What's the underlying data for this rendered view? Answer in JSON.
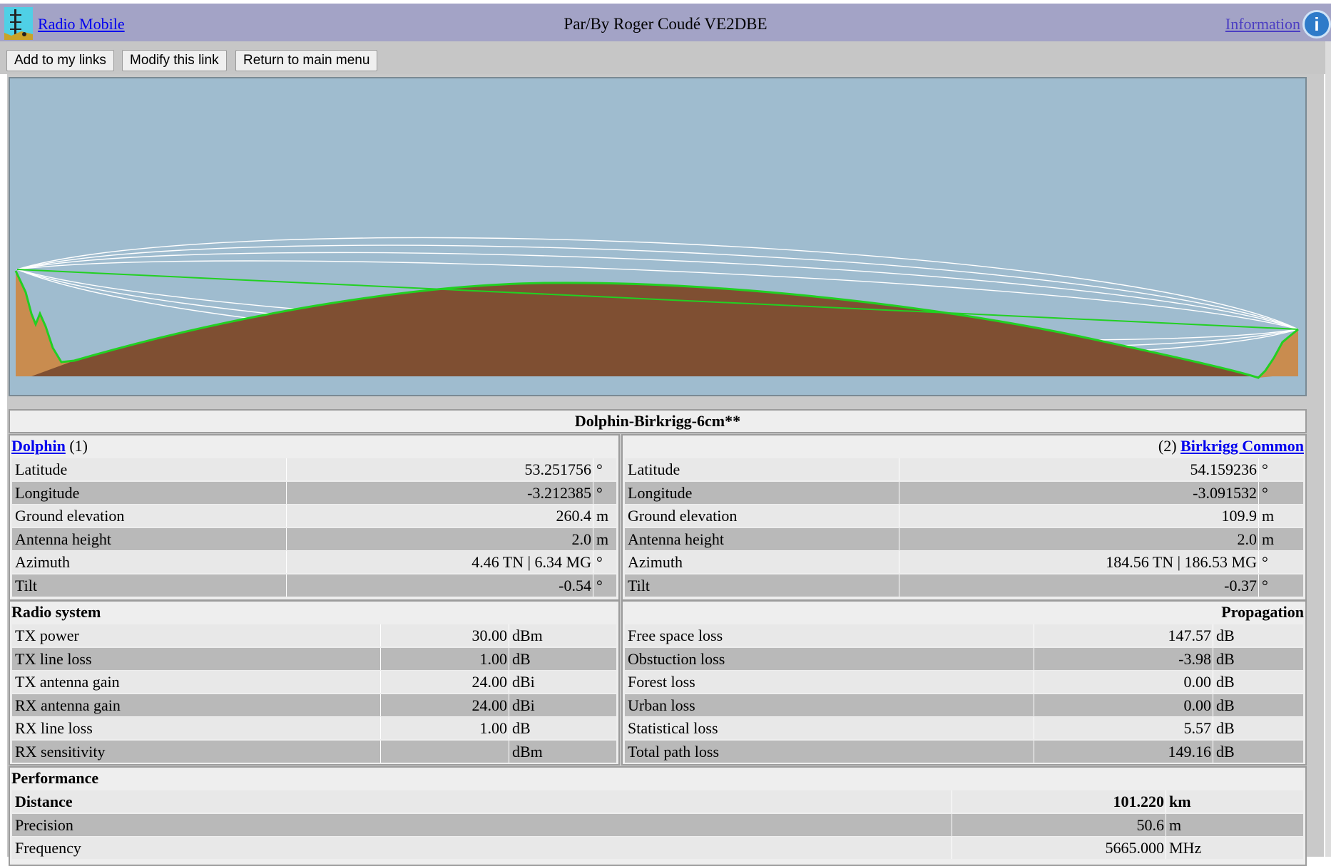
{
  "header": {
    "app_link": "Radio Mobile",
    "credit": "Par/By Roger Coudé VE2DBE",
    "info_link": "Information",
    "info_icon": "i"
  },
  "toolbar": {
    "add_label": "Add to my links",
    "modify_label": "Modify this link",
    "return_label": "Return to main menu"
  },
  "profile": {
    "sky_color": "#9fbccf",
    "terrain_color": "#7f4f32",
    "terrain_edge_color": "#c98c4f",
    "los_color": "#22d022",
    "fresnel_color": "#ffffff"
  },
  "link_title": "Dolphin-Birkrigg-6cm**",
  "site1": {
    "name": "Dolphin",
    "index": "(1)",
    "rows": [
      {
        "label": "Latitude",
        "value": "53.251756",
        "unit": "°"
      },
      {
        "label": "Longitude",
        "value": "-3.212385",
        "unit": "°"
      },
      {
        "label": "Ground elevation",
        "value": "260.4",
        "unit": "m"
      },
      {
        "label": "Antenna height",
        "value": "2.0",
        "unit": "m"
      },
      {
        "label": "Azimuth",
        "value": "4.46 TN | 6.34 MG",
        "unit": "°"
      },
      {
        "label": "Tilt",
        "value": "-0.54",
        "unit": "°"
      }
    ]
  },
  "site2": {
    "name": "Birkrigg Common",
    "index": "(2)",
    "rows": [
      {
        "label": "Latitude",
        "value": "54.159236",
        "unit": "°"
      },
      {
        "label": "Longitude",
        "value": "-3.091532",
        "unit": "°"
      },
      {
        "label": "Ground elevation",
        "value": "109.9",
        "unit": "m"
      },
      {
        "label": "Antenna height",
        "value": "2.0",
        "unit": "m"
      },
      {
        "label": "Azimuth",
        "value": "184.56 TN | 186.53 MG",
        "unit": "°"
      },
      {
        "label": "Tilt",
        "value": "-0.37",
        "unit": "°"
      }
    ]
  },
  "radio": {
    "title": "Radio system",
    "rows": [
      {
        "label": "TX power",
        "value": "30.00",
        "unit": "dBm"
      },
      {
        "label": "TX line loss",
        "value": "1.00",
        "unit": "dB"
      },
      {
        "label": "TX antenna gain",
        "value": "24.00",
        "unit": "dBi"
      },
      {
        "label": "RX antenna gain",
        "value": "24.00",
        "unit": "dBi"
      },
      {
        "label": "RX line loss",
        "value": "1.00",
        "unit": "dB"
      },
      {
        "label": "RX sensitivity",
        "value": "",
        "unit": "dBm"
      }
    ]
  },
  "propagation": {
    "title": "Propagation",
    "rows": [
      {
        "label": "Free space loss",
        "value": "147.57",
        "unit": "dB"
      },
      {
        "label": "Obstuction loss",
        "value": "-3.98",
        "unit": "dB"
      },
      {
        "label": "Forest loss",
        "value": "0.00",
        "unit": "dB"
      },
      {
        "label": "Urban loss",
        "value": "0.00",
        "unit": "dB"
      },
      {
        "label": "Statistical loss",
        "value": "5.57",
        "unit": "dB"
      },
      {
        "label": "Total path loss",
        "value": "149.16",
        "unit": "dB"
      }
    ]
  },
  "performance": {
    "title": "Performance",
    "rows": [
      {
        "label": "Distance",
        "value": "101.220",
        "unit": "km"
      },
      {
        "label": "Precision",
        "value": "50.6",
        "unit": "m"
      },
      {
        "label": "Frequency",
        "value": "5665.000",
        "unit": "MHz"
      }
    ]
  }
}
